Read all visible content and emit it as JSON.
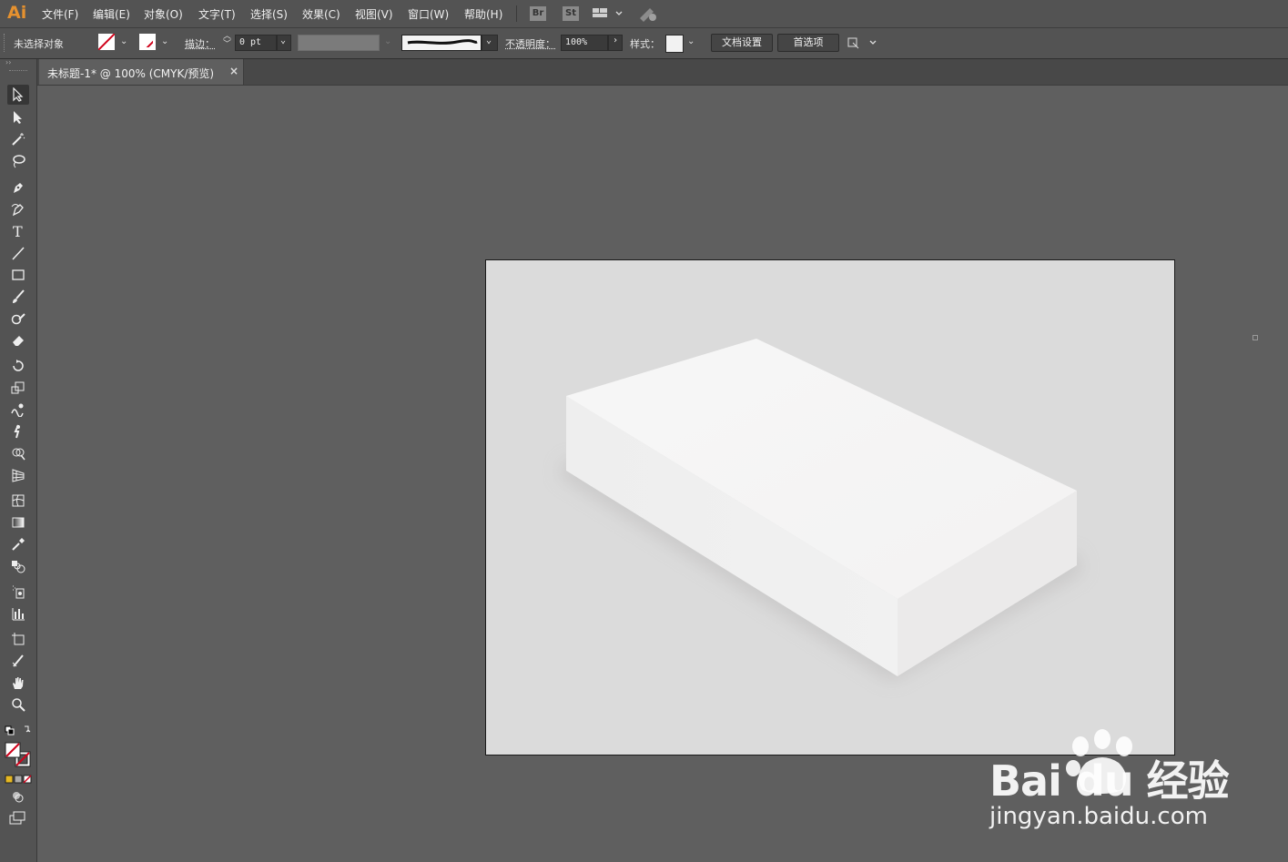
{
  "app": {
    "logo": "Ai"
  },
  "menu": [
    "文件(F)",
    "编辑(E)",
    "对象(O)",
    "文字(T)",
    "选择(S)",
    "效果(C)",
    "视图(V)",
    "窗口(W)",
    "帮助(H)"
  ],
  "bridge": {
    "br": "Br",
    "st": "St"
  },
  "options": {
    "selection_status": "未选择对象",
    "stroke_label": "描边：",
    "stroke_value": "0 pt",
    "opacity_label": "不透明度：",
    "opacity_value": "100%",
    "style_label": "样式：",
    "doc_setup": "文档设置",
    "preferences": "首选项"
  },
  "document": {
    "tab_title": "未标题-1* @ 100% (CMYK/预览)"
  },
  "colors": {
    "ui_bg": "#535353",
    "canvas_bg": "#5f5f5f",
    "artboard": "#dbdbdb",
    "accent_logo": "#e5912f",
    "box_top": "#f6f5f5",
    "box_left": "#efefef",
    "box_right": "#ebeaea"
  },
  "watermark": {
    "brand": "Bai du 经验",
    "url": "jingyan.baidu.com"
  },
  "tools": [
    "selection-tool",
    "direct-selection-tool",
    "magic-wand-tool",
    "lasso-tool",
    "pen-tool",
    "curvature-tool",
    "type-tool",
    "line-segment-tool",
    "rectangle-tool",
    "paintbrush-tool",
    "shaper-tool",
    "eraser-tool",
    "rotate-tool",
    "scale-tool",
    "warp-tool",
    "puppet-warp-tool",
    "shape-builder-tool",
    "perspective-grid-tool",
    "mesh-tool",
    "gradient-tool",
    "eyedropper-tool",
    "blend-tool",
    "symbol-sprayer-tool",
    "column-graph-tool",
    "artboard-tool",
    "slice-tool",
    "hand-tool",
    "zoom-tool"
  ]
}
